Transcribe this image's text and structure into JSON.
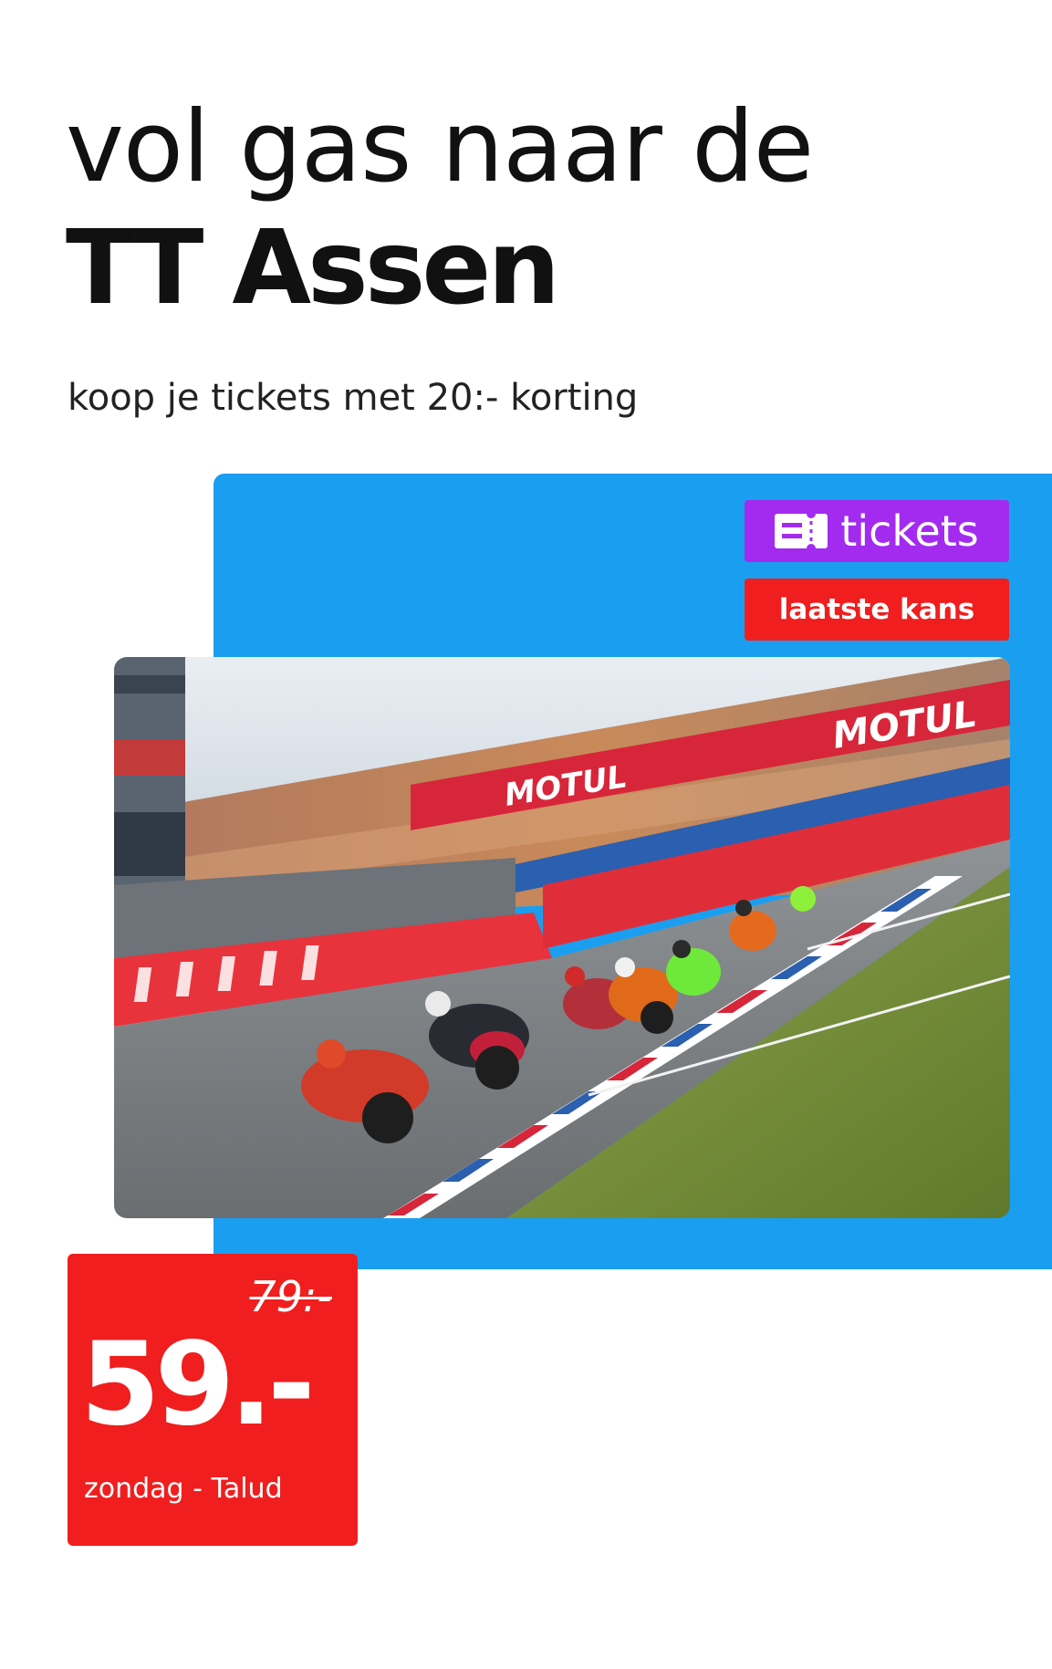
{
  "headline": {
    "line1": "vol gas naar de",
    "line2": "TT Assen"
  },
  "subline": "koop je tickets met 20:- korting",
  "badges": {
    "tickets_label": "tickets",
    "tickets_icon": "ticket-icon",
    "last_chance": "laatste kans"
  },
  "photo": {
    "banner_text": "MOTUL"
  },
  "price": {
    "old": "79:-",
    "new": "59.-",
    "note": "zondag - Talud"
  },
  "colors": {
    "panel_blue": "#1a9ff0",
    "tickets_purple": "#a32bf0",
    "accent_red": "#f01e1e"
  }
}
